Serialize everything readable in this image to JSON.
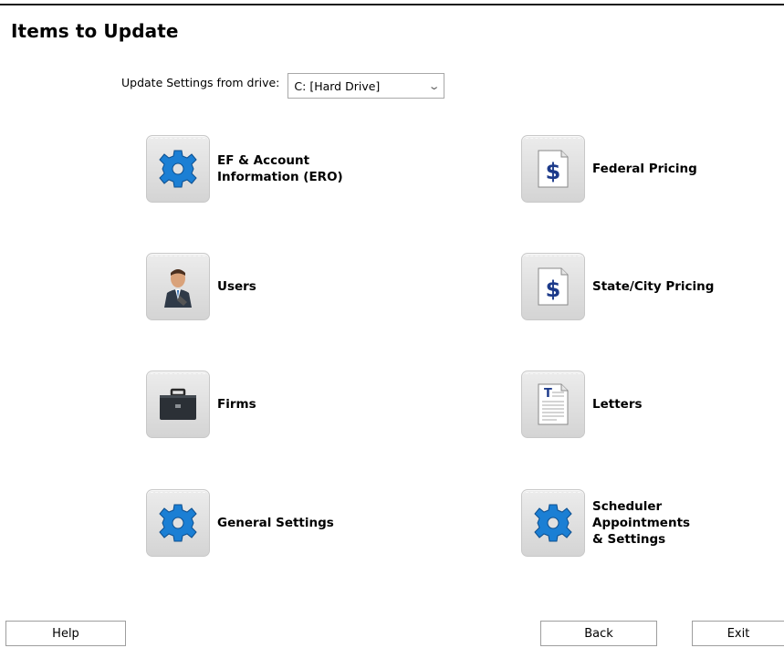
{
  "title": "Items to Update",
  "drive": {
    "label": "Update Settings from drive:",
    "value": "C: [Hard Drive]"
  },
  "items": [
    {
      "label": "EF & Account\nInformation (ERO)",
      "icon": "gear-icon"
    },
    {
      "label": "Federal Pricing",
      "icon": "dollar-document-icon"
    },
    {
      "label": "Users",
      "icon": "user-icon"
    },
    {
      "label": "State/City Pricing",
      "icon": "dollar-document-icon"
    },
    {
      "label": "Firms",
      "icon": "briefcase-icon"
    },
    {
      "label": "Letters",
      "icon": "letter-document-icon"
    },
    {
      "label": "General Settings",
      "icon": "gear-icon"
    },
    {
      "label": "Scheduler\nAppointments\n& Settings",
      "icon": "gear-icon"
    }
  ],
  "buttons": {
    "help": "Help",
    "back": "Back",
    "exit": "Exit"
  },
  "colors": {
    "gear": "#1b7fd4",
    "dollar": "#1c3a8a"
  }
}
